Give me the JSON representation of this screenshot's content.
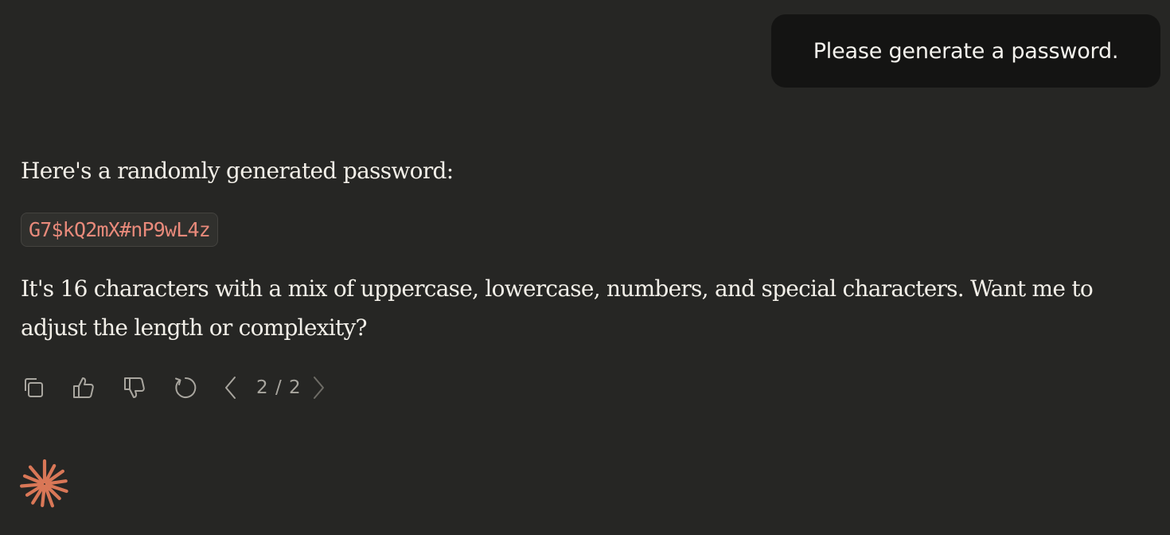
{
  "user_message": {
    "text": "Please generate a password."
  },
  "assistant_message": {
    "intro": "Here's a randomly generated password:",
    "password": "G7$kQ2mX#nP9wL4z",
    "body": "It's 16 characters with a mix of uppercase, lowercase, numbers, and special characters. Want me to adjust the length or complexity?"
  },
  "actions": {
    "icons": [
      "copy-icon",
      "thumbs-up-icon",
      "thumbs-down-icon",
      "retry-icon",
      "chevron-left-icon",
      "chevron-right-icon"
    ],
    "pager": "2 / 2"
  },
  "colors": {
    "background": "#262624",
    "user_bubble": "#141413",
    "code_text": "#e98a7b",
    "accent_logo": "#d97757",
    "icon": "#a9a69f"
  }
}
